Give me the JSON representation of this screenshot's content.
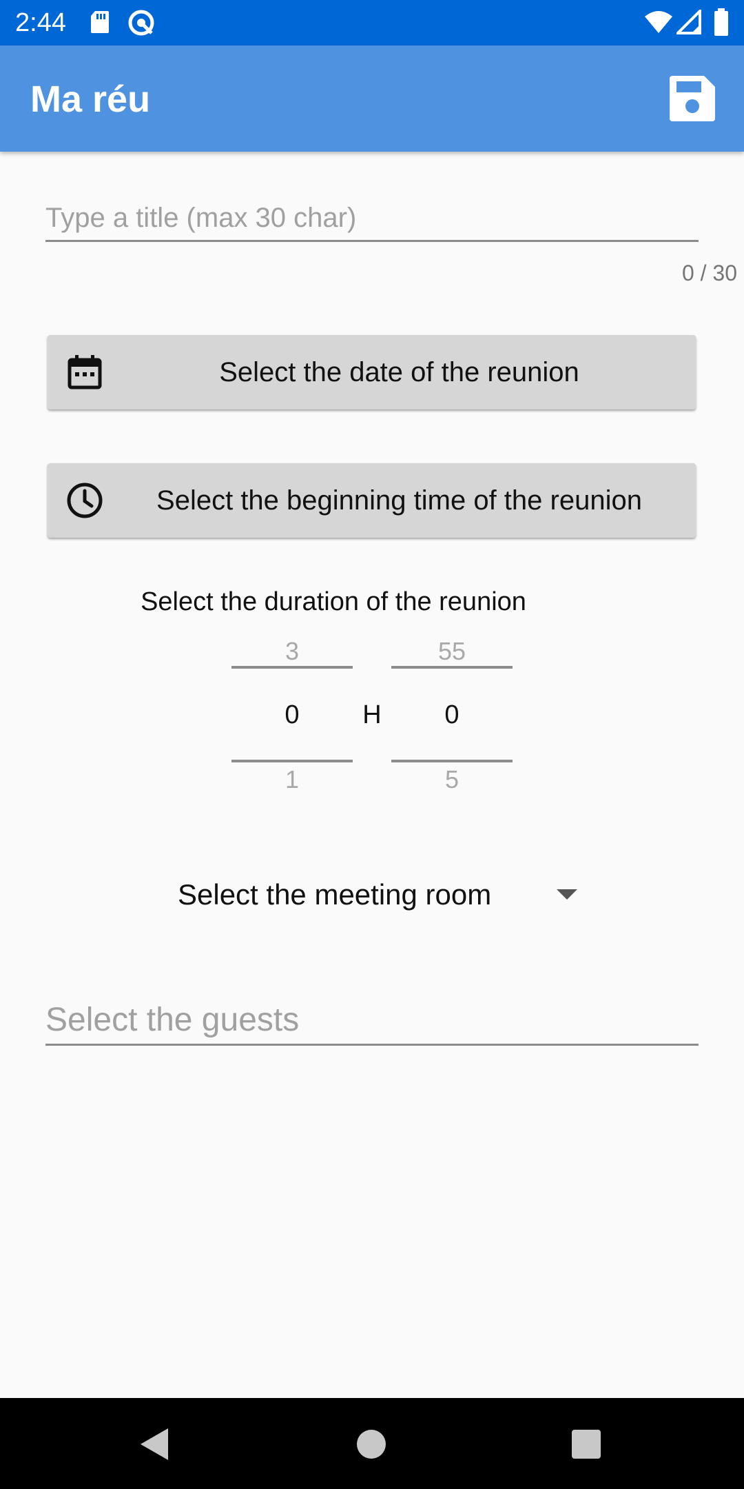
{
  "status_bar": {
    "time": "2:44",
    "icons": [
      "sd-card-icon",
      "sync-icon",
      "wifi-icon",
      "signal-icon",
      "battery-icon"
    ]
  },
  "app_bar": {
    "title": "Ma réu",
    "save_icon": "save-icon"
  },
  "title_field": {
    "placeholder": "Type a title (max 30 char)",
    "value": "",
    "counter": "0 / 30"
  },
  "date_button": {
    "label": "Select the date of the reunion",
    "icon": "calendar-icon"
  },
  "time_button": {
    "label": "Select the beginning time of the reunion",
    "icon": "clock-icon"
  },
  "duration": {
    "label": "Select the duration of the reunion",
    "hours": {
      "prev": "3",
      "current": "0",
      "next": "1"
    },
    "separator": "H",
    "minutes": {
      "prev": "55",
      "current": "0",
      "next": "5"
    }
  },
  "room": {
    "label": "Select the meeting room",
    "icon": "dropdown-arrow-icon"
  },
  "guests_field": {
    "placeholder": "Select the guests",
    "value": ""
  },
  "nav_bar": {
    "buttons": [
      "back-icon",
      "home-icon",
      "recents-icon"
    ]
  },
  "colors": {
    "status_bar": "#0067d6",
    "app_bar": "#4f93e0",
    "button_bg": "#d6d6d6",
    "background": "#fafafa"
  }
}
